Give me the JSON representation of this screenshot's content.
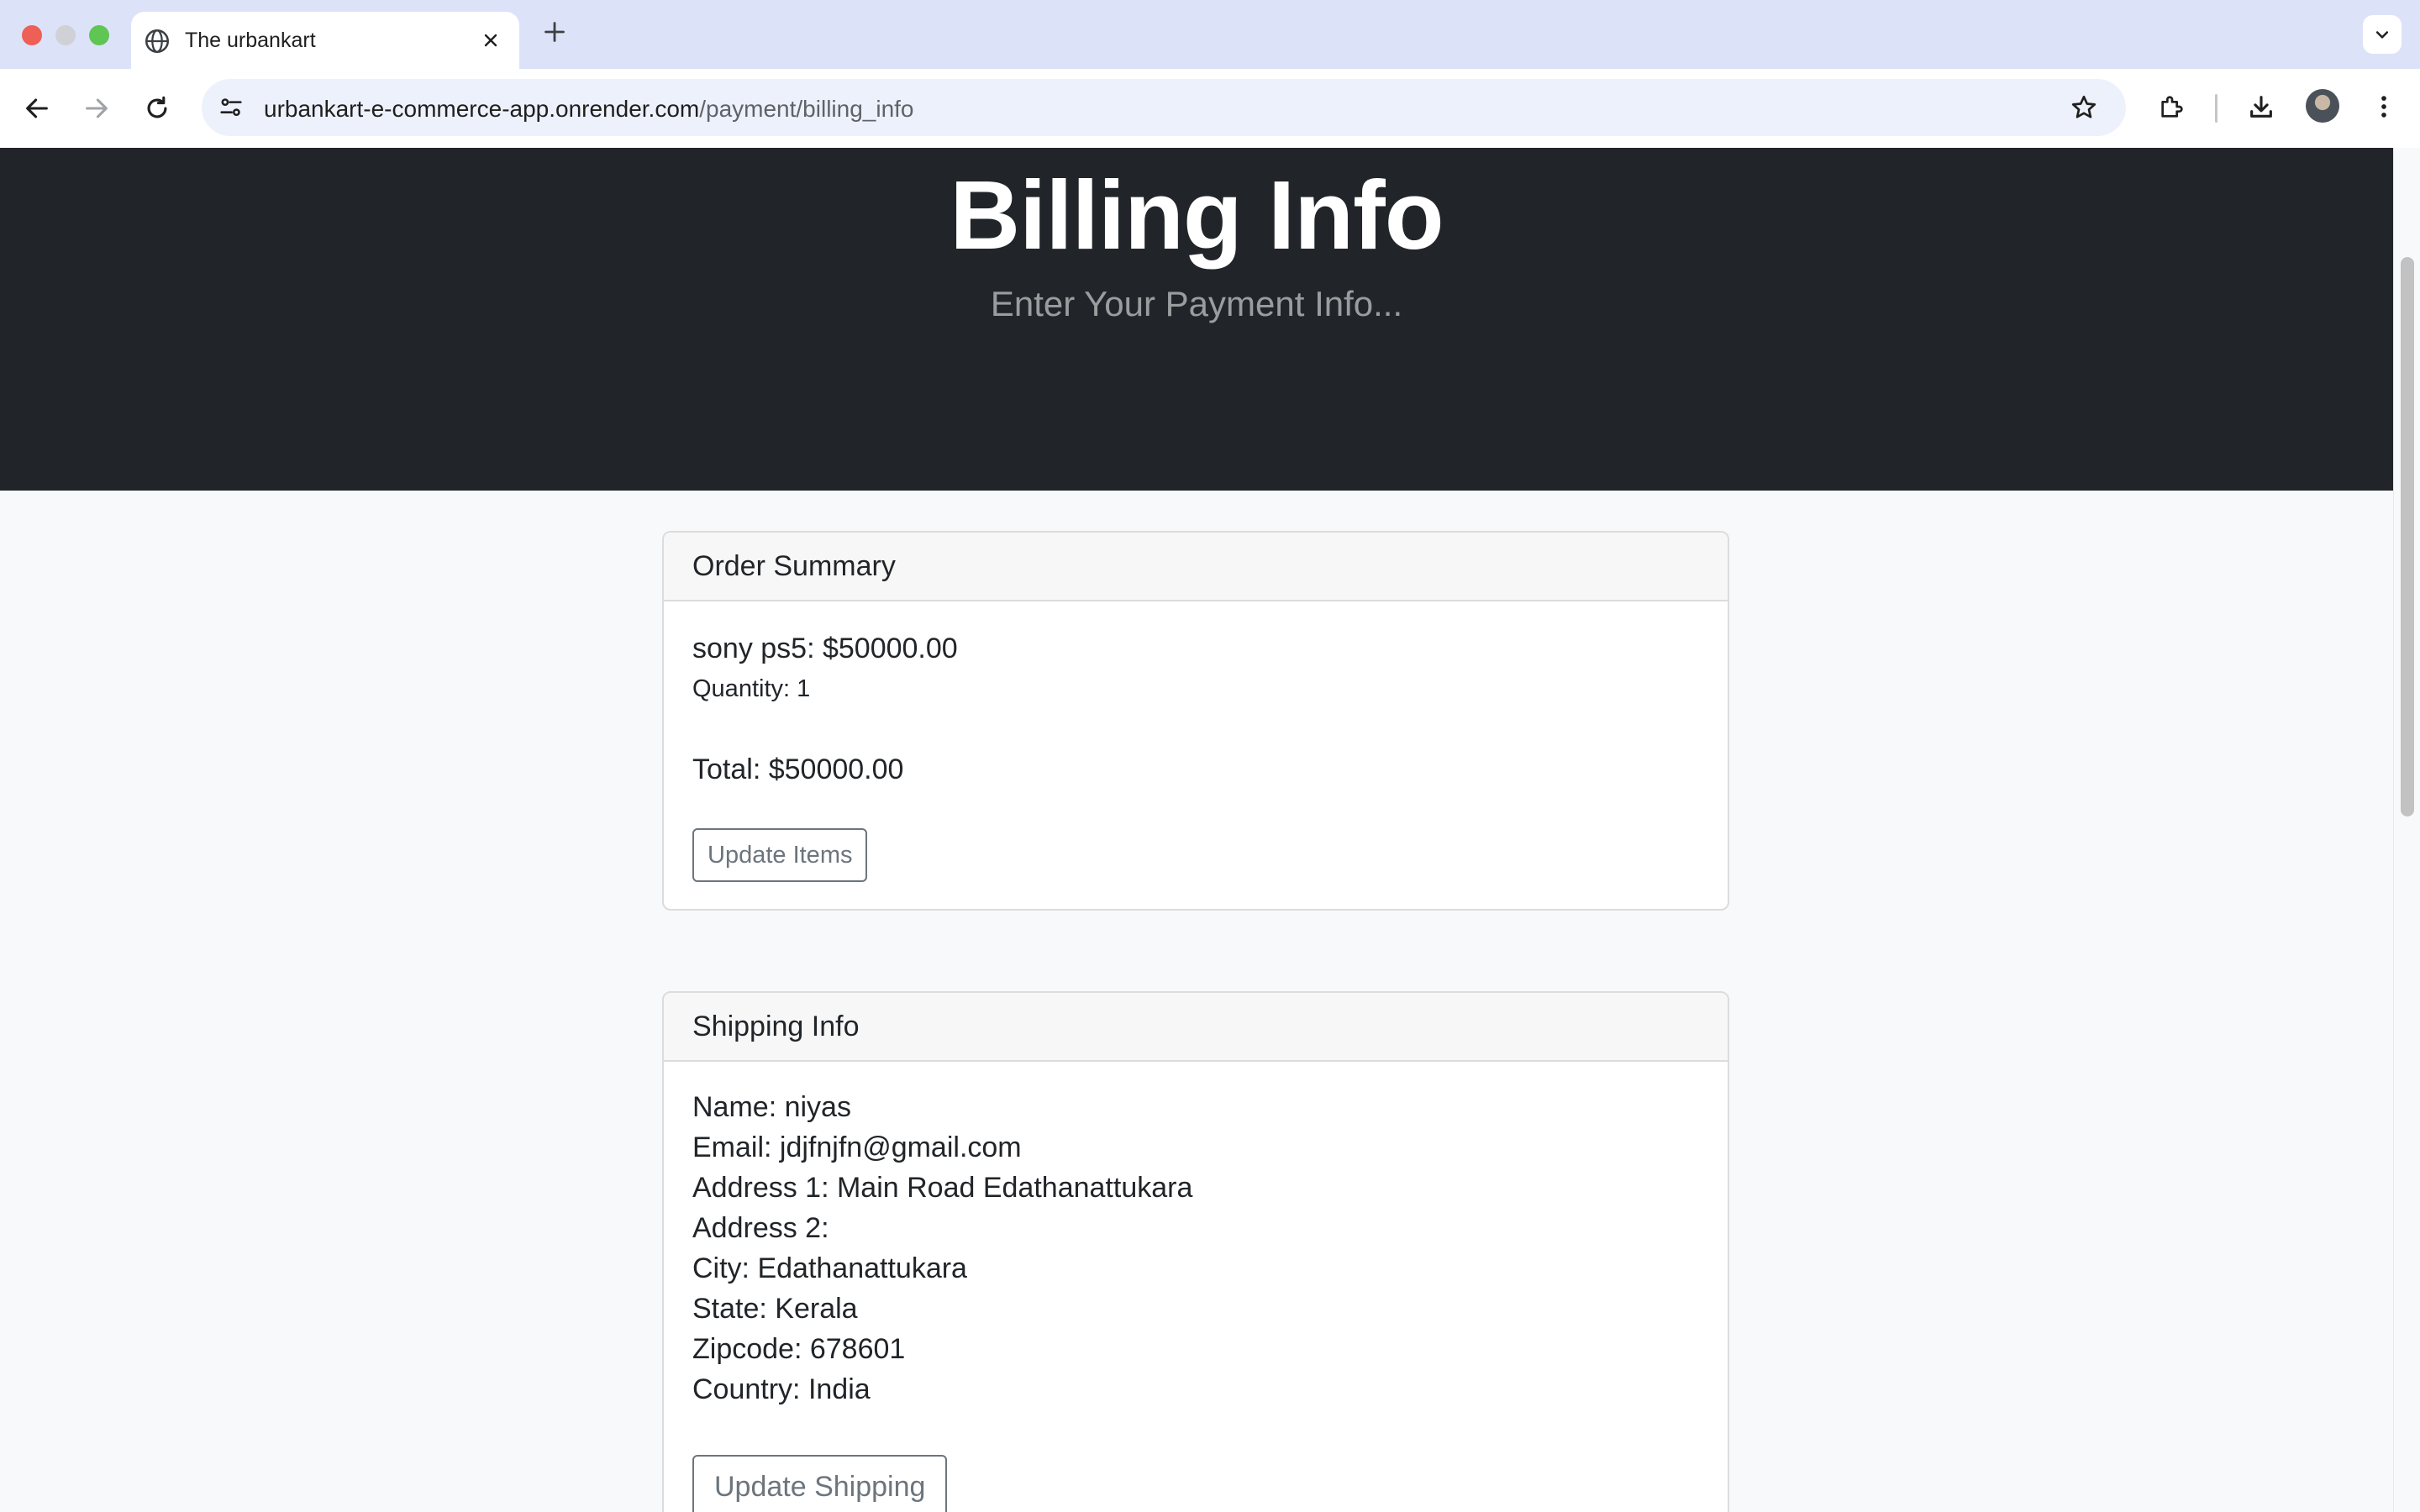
{
  "browser": {
    "tab_title": "The urbankart",
    "url_host": "urbankart-e-commerce-app.onrender.com",
    "url_path": "/payment/billing_info"
  },
  "hero": {
    "title": "Billing Info",
    "subtitle": "Enter Your Payment Info..."
  },
  "order_summary": {
    "header": "Order Summary",
    "item_line": "sony ps5: $50000.00",
    "quantity_line": "Quantity: 1",
    "total_line": "Total: $50000.00",
    "button_label": "Update Items"
  },
  "shipping_info": {
    "header": "Shipping Info",
    "lines": [
      "Name: niyas",
      "Email: jdjfnjfn@gmail.com",
      "Address 1: Main Road Edathanattukara",
      "Address 2:",
      "City: Edathanattukara",
      "State: Kerala",
      "Zipcode: 678601",
      "Country: India"
    ],
    "button_label": "Update Shipping"
  },
  "colors": {
    "hero_bg": "#212529",
    "page_bg": "#f8f9fa",
    "tabbar_bg": "#dce3f8",
    "button_outline": "#6c757d"
  },
  "icons": {
    "tab": "globe-icon",
    "toolbar": [
      "back-arrow-icon",
      "forward-arrow-icon",
      "reload-icon",
      "site-info-icon",
      "bookmark-star-icon",
      "extensions-icon",
      "download-icon",
      "profile-avatar-icon",
      "menu-kebab-icon"
    ]
  }
}
